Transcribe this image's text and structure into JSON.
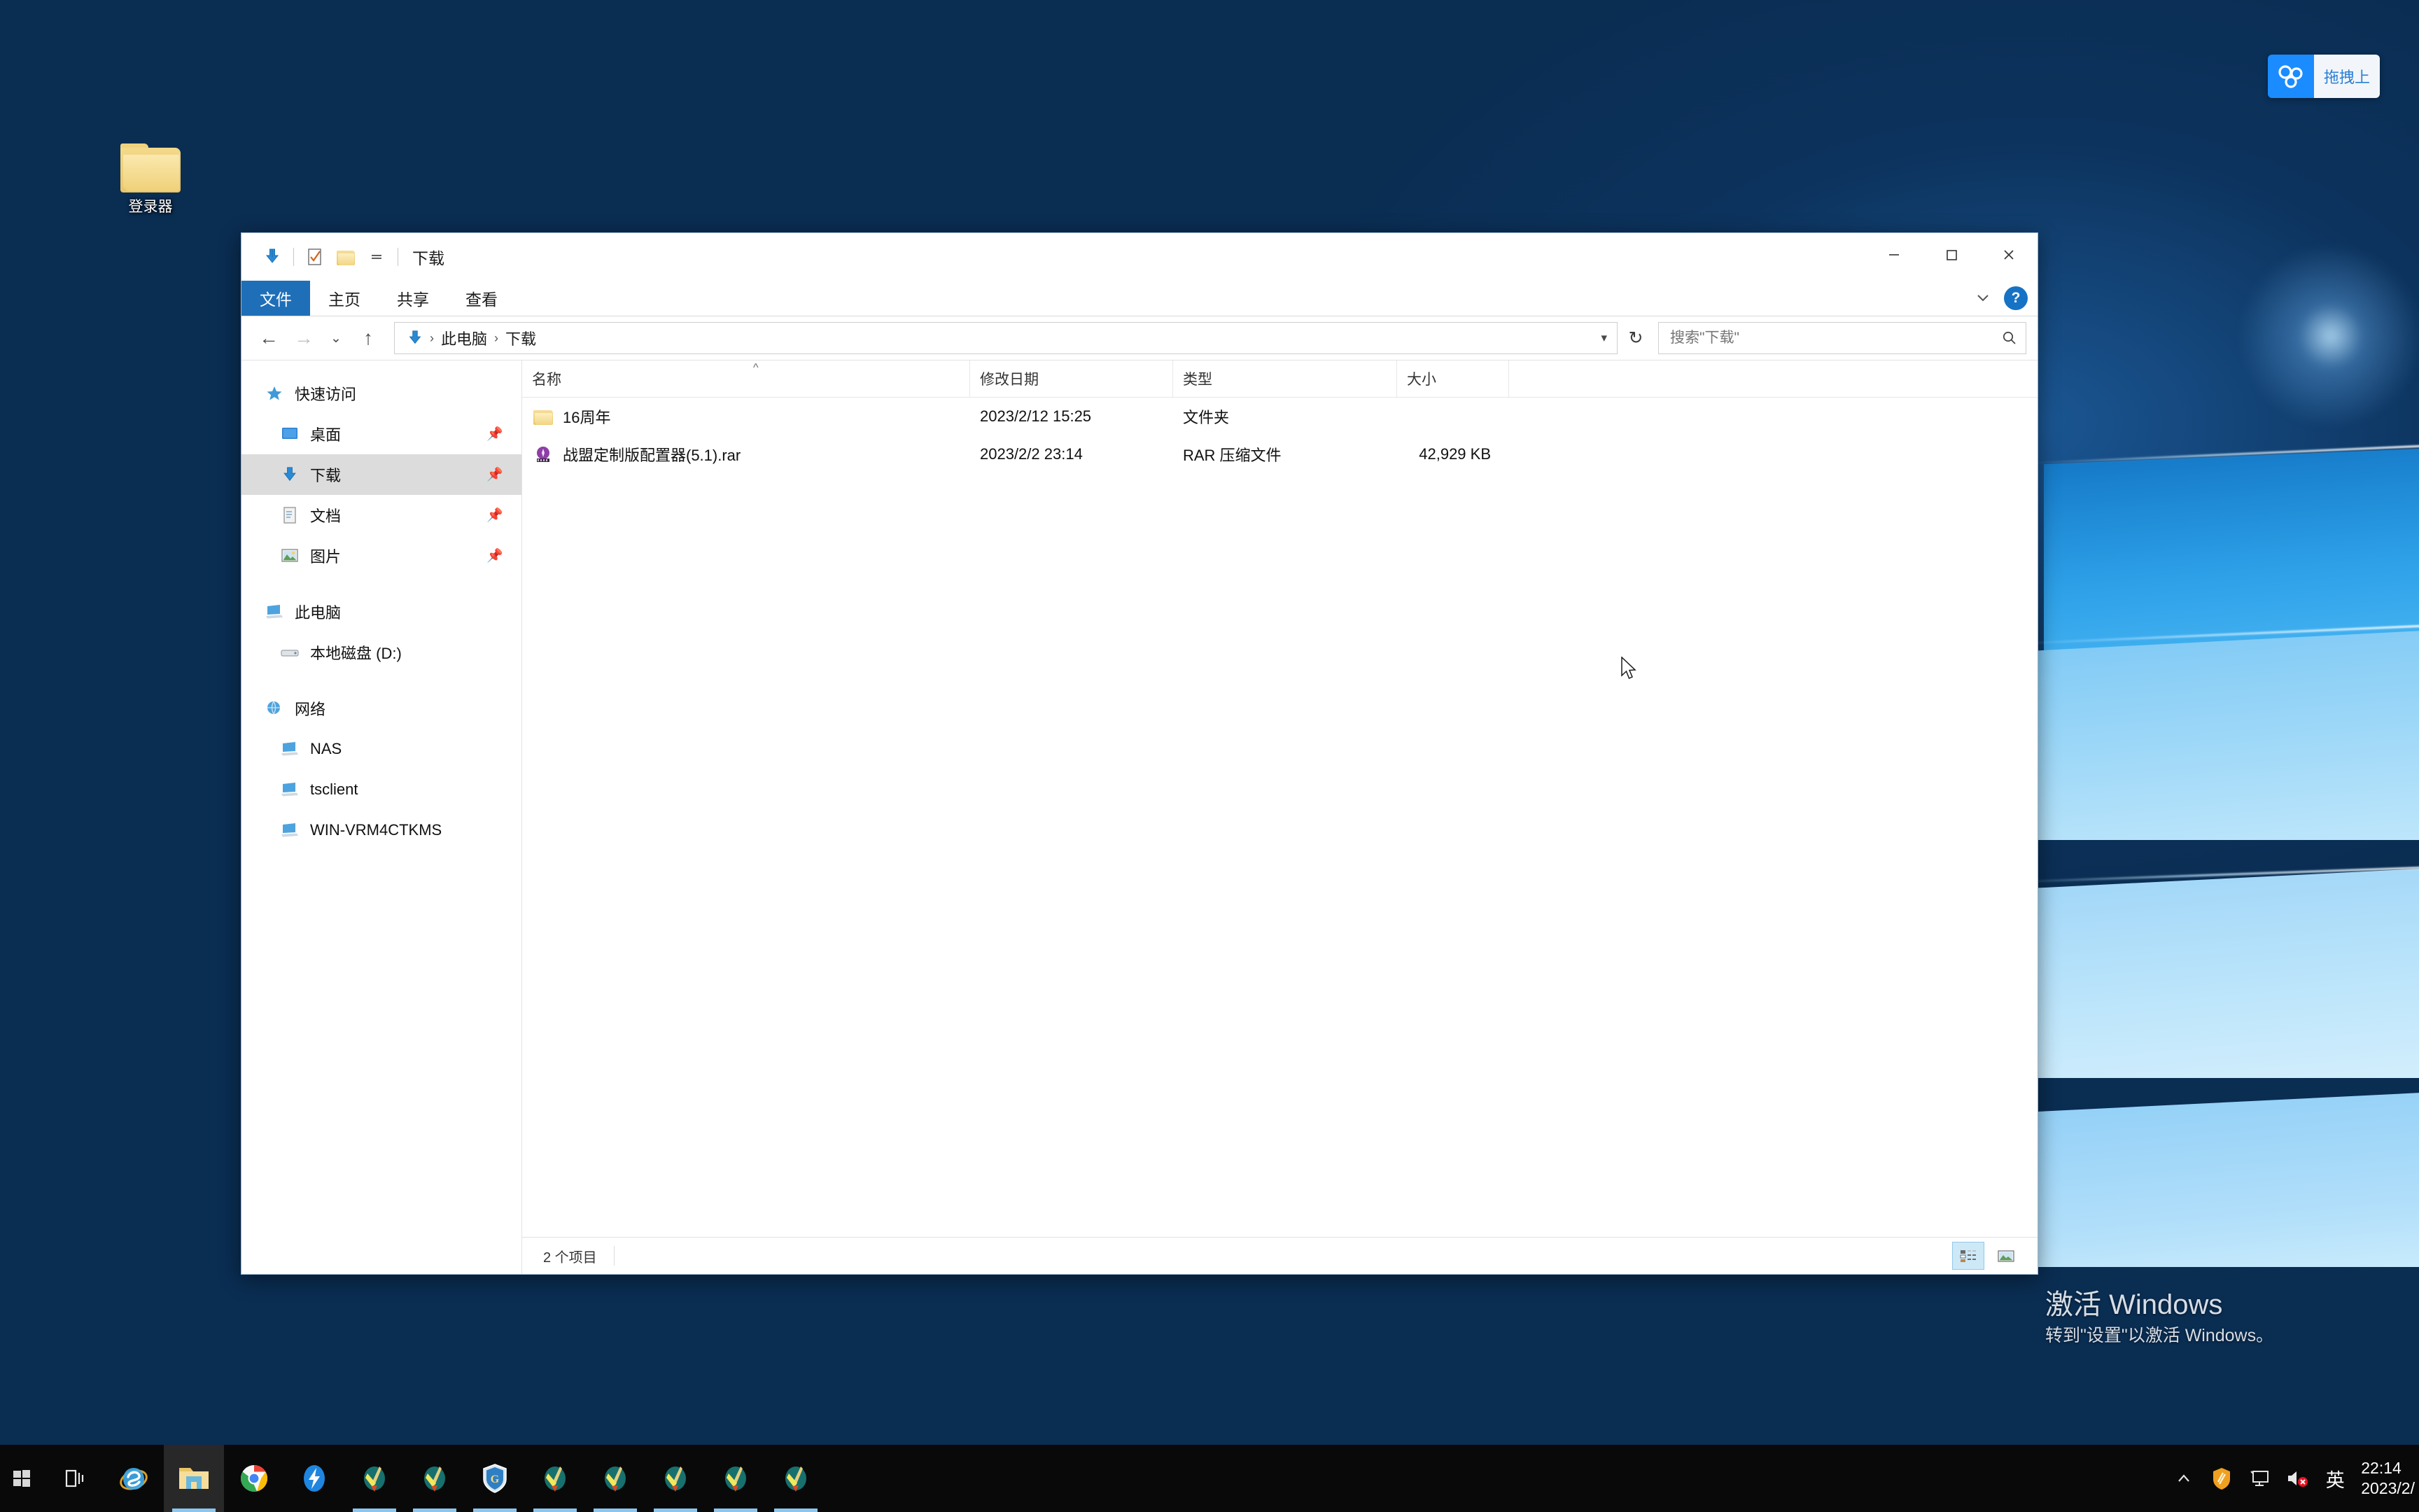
{
  "desktop": {
    "icons": [
      {
        "label": "登录器",
        "icon": "folder-icon"
      }
    ],
    "watermark": {
      "line1": "激活 Windows",
      "line2": "转到\"设置\"以激活 Windows。"
    },
    "cloud_widget": {
      "icon": "baidu-netdisk-icon",
      "text": "拖拽上"
    }
  },
  "window": {
    "title": "下载",
    "quick_access": [
      {
        "name": "downloads-icon",
        "label": "下载"
      },
      {
        "name": "properties-icon",
        "label": "属性"
      },
      {
        "name": "new-folder-icon",
        "label": "新建文件夹"
      },
      {
        "name": "customize-toolbar-icon",
        "label": "自定义快速访问工具栏"
      }
    ],
    "controls": {
      "minimize": "−",
      "maximize": "□",
      "close": "✕",
      "collapse_ribbon": "⌄",
      "help": "?"
    },
    "tabs": [
      {
        "label": "文件",
        "active": true
      },
      {
        "label": "主页",
        "active": false
      },
      {
        "label": "共享",
        "active": false
      },
      {
        "label": "查看",
        "active": false
      }
    ],
    "address": {
      "back": "←",
      "forward": "→",
      "recent": "⌄",
      "up": "↑",
      "crumbs": [
        "此电脑",
        "下载"
      ],
      "refresh": "↻"
    },
    "search": {
      "placeholder": "搜索\"下载\""
    },
    "sidebar": [
      {
        "label": "快速访问",
        "icon": "star-icon",
        "level": 0,
        "selected": false,
        "pinned": false
      },
      {
        "label": "桌面",
        "icon": "desktop-icon",
        "level": 1,
        "selected": false,
        "pinned": true
      },
      {
        "label": "下载",
        "icon": "downloads-icon",
        "level": 1,
        "selected": true,
        "pinned": true
      },
      {
        "label": "文档",
        "icon": "documents-icon",
        "level": 1,
        "selected": false,
        "pinned": true
      },
      {
        "label": "图片",
        "icon": "pictures-icon",
        "level": 1,
        "selected": false,
        "pinned": true
      },
      {
        "label": "此电脑",
        "icon": "this-pc-icon",
        "level": 0,
        "selected": false,
        "pinned": false
      },
      {
        "label": "本地磁盘 (D:)",
        "icon": "drive-icon",
        "level": 1,
        "selected": false,
        "pinned": false
      },
      {
        "label": "网络",
        "icon": "network-icon",
        "level": 0,
        "selected": false,
        "pinned": false
      },
      {
        "label": "NAS",
        "icon": "computer-icon",
        "level": 1,
        "selected": false,
        "pinned": false
      },
      {
        "label": "tsclient",
        "icon": "computer-icon",
        "level": 1,
        "selected": false,
        "pinned": false
      },
      {
        "label": "WIN-VRM4CTKMS",
        "icon": "computer-icon",
        "level": 1,
        "selected": false,
        "pinned": false
      }
    ],
    "columns": [
      {
        "label": "名称",
        "key": "name"
      },
      {
        "label": "修改日期",
        "key": "date"
      },
      {
        "label": "类型",
        "key": "type"
      },
      {
        "label": "大小",
        "key": "size"
      }
    ],
    "files": [
      {
        "name": "16周年",
        "date": "2023/2/12 15:25",
        "type": "文件夹",
        "size": "",
        "icon": "folder-icon"
      },
      {
        "name": "战盟定制版配置器(5.1).rar",
        "date": "2023/2/2 23:14",
        "type": "RAR 压缩文件",
        "size": "42,929 KB",
        "icon": "rar-archive-icon"
      }
    ],
    "status": {
      "count": "2 个项目"
    },
    "view_buttons": [
      {
        "name": "details-view-button",
        "active": true
      },
      {
        "name": "large-icons-view-button",
        "active": false
      }
    ]
  },
  "taskbar": {
    "start": {
      "icon": "windows-start-icon"
    },
    "items": [
      {
        "name": "task-view-icon",
        "type": "taskview",
        "running": false
      },
      {
        "name": "internet-explorer-icon",
        "type": "ie",
        "running": false
      },
      {
        "name": "file-explorer-icon",
        "type": "explorer",
        "running": true,
        "active": true
      },
      {
        "name": "google-chrome-icon",
        "type": "chrome",
        "running": false
      },
      {
        "name": "thunder-app-icon",
        "type": "thunder",
        "running": false
      },
      {
        "name": "game-client-icon",
        "type": "game",
        "running": true
      },
      {
        "name": "game-client-icon",
        "type": "game",
        "running": true
      },
      {
        "name": "shield-app-icon",
        "type": "shield",
        "running": true
      },
      {
        "name": "game-client-icon",
        "type": "game",
        "running": true
      },
      {
        "name": "game-client-icon",
        "type": "game",
        "running": true
      },
      {
        "name": "game-client-icon",
        "type": "game",
        "running": true
      },
      {
        "name": "game-client-icon",
        "type": "game",
        "running": true
      },
      {
        "name": "game-client-icon",
        "type": "game",
        "running": true
      }
    ],
    "tray": [
      {
        "name": "show-hidden-icons-chevron",
        "glyph": "⌃"
      },
      {
        "name": "security-shield-icon",
        "glyph": "shield"
      },
      {
        "name": "network-monitor-icon",
        "glyph": "monitor"
      },
      {
        "name": "volume-muted-icon",
        "glyph": "speaker-muted"
      },
      {
        "name": "ime-indicator",
        "glyph": "英"
      }
    ],
    "clock": {
      "time": "22:14",
      "date": "2023/2/"
    }
  },
  "colors": {
    "accent": "#1e6fb8",
    "selection": "#dcdcdc",
    "taskbar": "#090909",
    "folder": "#f0d179",
    "rar": "#8e3ea8"
  }
}
